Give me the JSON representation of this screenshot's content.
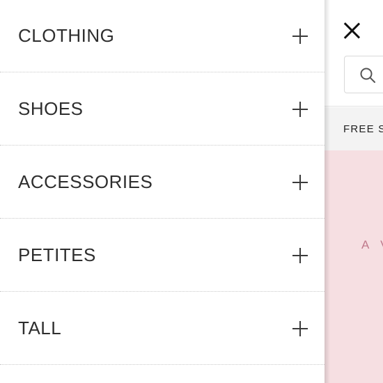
{
  "menu": {
    "items": [
      {
        "label": "CLOTHING",
        "expand_icon": "plus-icon"
      },
      {
        "label": "SHOES",
        "expand_icon": "plus-icon"
      },
      {
        "label": "ACCESSORIES",
        "expand_icon": "plus-icon"
      },
      {
        "label": "PETITES",
        "expand_icon": "plus-icon"
      },
      {
        "label": "TALL",
        "expand_icon": "plus-icon"
      }
    ]
  },
  "header": {
    "close_icon": "close-icon",
    "search_icon": "search-icon"
  },
  "promo": {
    "text": "FREE S"
  },
  "hero": {
    "text": "A V",
    "background_color": "#f6dfe2",
    "text_color": "#c07a8c"
  }
}
